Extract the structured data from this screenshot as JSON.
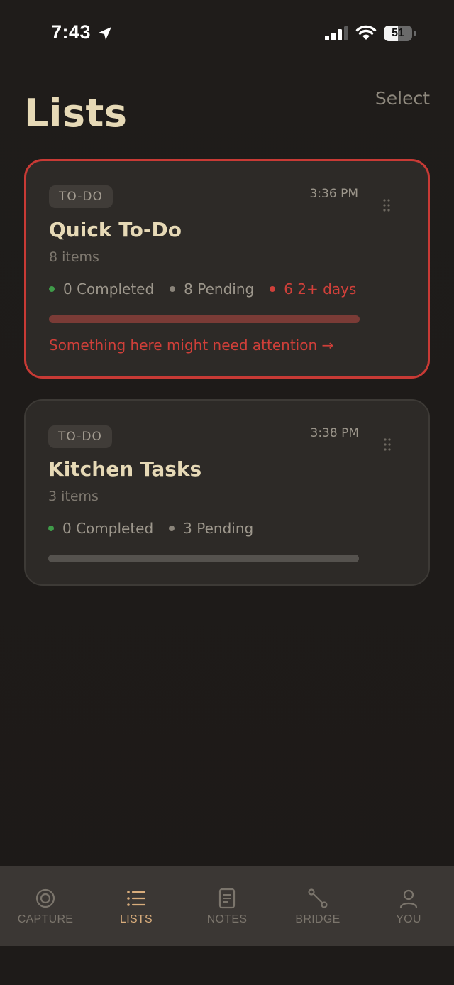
{
  "status_bar": {
    "time": "7:43",
    "battery_level": "51",
    "battery_fraction": 0.51
  },
  "header": {
    "title": "Lists",
    "select_label": "Select"
  },
  "lists": [
    {
      "type": "TO-DO",
      "time": "3:36 PM",
      "title": "Quick To-Do",
      "count": "8 items",
      "completed": "0 Completed",
      "pending": "8 Pending",
      "overdue": "6 2+ days",
      "progress_fraction": 0,
      "attention": "Something here might need attention →",
      "highlight_color": "#c83a35"
    },
    {
      "type": "TO-DO",
      "time": "3:38 PM",
      "title": "Kitchen Tasks",
      "count": "3 items",
      "completed": "0 Completed",
      "pending": "3 Pending",
      "progress_fraction": 0
    }
  ],
  "tabs": [
    {
      "label": "CAPTURE",
      "icon": "target-icon",
      "active": false
    },
    {
      "label": "LISTS",
      "icon": "list-icon",
      "active": true
    },
    {
      "label": "NOTES",
      "icon": "document-icon",
      "active": false
    },
    {
      "label": "BRIDGE",
      "icon": "bridge-icon",
      "active": false
    },
    {
      "label": "YOU",
      "icon": "person-icon",
      "active": false
    }
  ],
  "colors": {
    "accent": "#d9ad7c",
    "title": "#e6d9b6",
    "alert": "#d0403a",
    "completed": "#3f9b49"
  }
}
